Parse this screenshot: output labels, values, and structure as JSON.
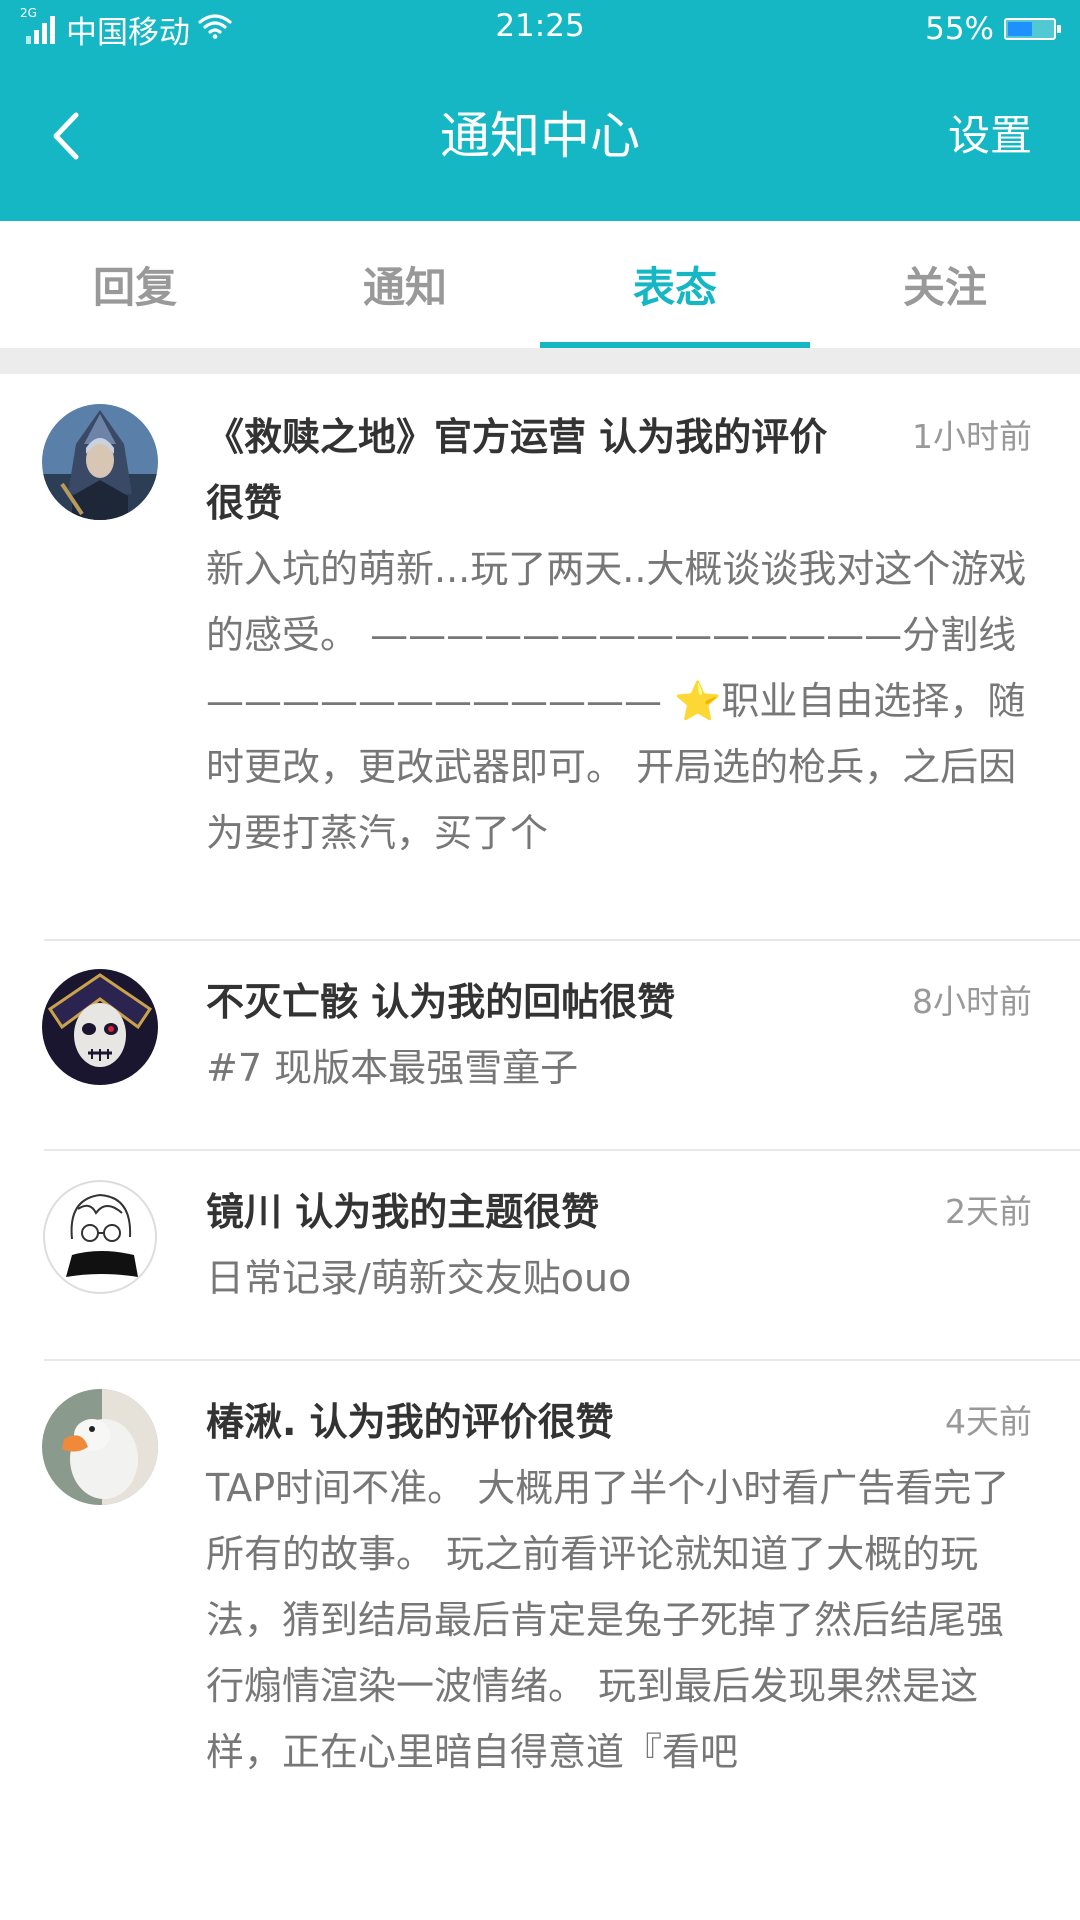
{
  "status_bar": {
    "network_type": "2G",
    "carrier": "中国移动",
    "time": "21:25",
    "battery_percent": "55%",
    "battery_level": 0.55,
    "battery_color": "#1e90ff"
  },
  "header": {
    "title": "通知中心",
    "settings_label": "设置",
    "background_color": "#16b7c5"
  },
  "tabs": [
    {
      "label": "回复",
      "active": false
    },
    {
      "label": "通知",
      "active": false
    },
    {
      "label": "表态",
      "active": true
    },
    {
      "label": "关注",
      "active": false
    }
  ],
  "notifications": [
    {
      "title": "《救赎之地》官方运营 认为我的评价很赞",
      "time": "1小时前",
      "body": "新入坑的萌新...玩了两天..大概谈谈我对这个游戏的感受。 ——————————————分割线———————————— ⭐职业自由选择，随时更改，更改武器即可。 开局选的枪兵，之后因为要打蒸汽，买了个",
      "avatar_icon": "hooded-warrior-avatar"
    },
    {
      "title": "不灭亡骸 认为我的回帖很赞",
      "time": "8小时前",
      "body": "#7 现版本最强雪童子",
      "avatar_icon": "skull-mask-avatar"
    },
    {
      "title": "镜川 认为我的主题很赞",
      "time": "2天前",
      "body": "日常记录/萌新交友贴ouo",
      "avatar_icon": "sketch-girl-avatar"
    },
    {
      "title": "椿湫. 认为我的评价很赞",
      "time": "4天前",
      "body": "TAP时间不准。 大概用了半个小时看广告看完了所有的故事。 玩之前看评论就知道了大概的玩法，猜到结局最后肯定是兔子死掉了然后结尾强行煽情渲染一波情绪。 玩到最后发现果然是这样，正在心里暗自得意道『看吧",
      "avatar_icon": "goose-avatar"
    }
  ]
}
